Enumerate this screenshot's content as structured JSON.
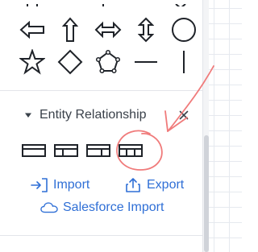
{
  "colors": {
    "icon_dark": "#1f2329",
    "link_blue": "#2f6fd6",
    "annotation_red": "#f07b7b"
  },
  "shape_rows": [
    [
      {
        "name": "arrow-left-icon"
      },
      {
        "name": "arrow-up-icon"
      },
      {
        "name": "arrow-left-right-icon"
      },
      {
        "name": "arrow-up-down-icon"
      },
      {
        "name": "circle-icon"
      }
    ],
    [
      {
        "name": "star-icon"
      },
      {
        "name": "diamond-icon"
      },
      {
        "name": "pentagon-icon"
      },
      {
        "name": "horizontal-line-icon"
      },
      {
        "name": "vertical-line-icon"
      }
    ]
  ],
  "section": {
    "title": "Entity Relationship",
    "close_icon": "close-icon",
    "collapse_icon": "caret-down-icon",
    "shapes": [
      {
        "name": "er-entity-single-icon"
      },
      {
        "name": "er-entity-two-column-icon"
      },
      {
        "name": "er-entity-two-column-alt-icon"
      },
      {
        "name": "er-entity-three-column-icon"
      }
    ]
  },
  "actions": {
    "import_label": "Import",
    "export_label": "Export",
    "salesforce_label": "Salesforce Import"
  }
}
